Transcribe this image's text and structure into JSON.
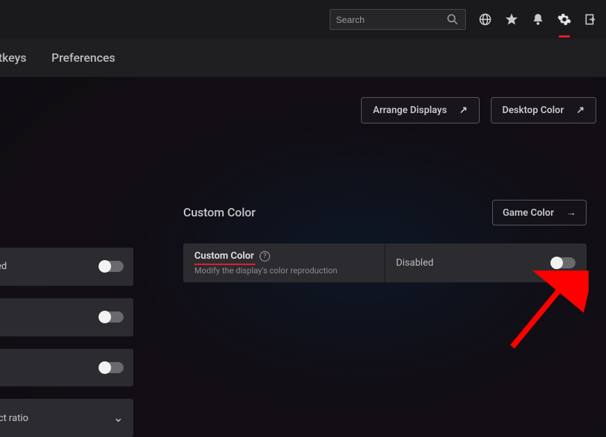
{
  "topbar": {
    "search_placeholder": "Search",
    "icons": [
      "globe",
      "star",
      "bell",
      "gear",
      "exit"
    ],
    "active_icon": "gear"
  },
  "tabs": {
    "hotkeys_label": "otkeys",
    "preferences_label": "Preferences"
  },
  "top_buttons": {
    "arrange_label": "Arrange Displays",
    "desktop_color_label": "Desktop Color"
  },
  "section": {
    "title": "Custom Color",
    "game_color_label": "Game Color",
    "card_title": "Custom Color",
    "card_sub": "Modify the display's color reproduction",
    "state_label": "Disabled"
  },
  "rail": {
    "row1_trailing": "ted",
    "row4_text": "ect ratio"
  },
  "colors": {
    "accent": "#ed1c2e"
  }
}
